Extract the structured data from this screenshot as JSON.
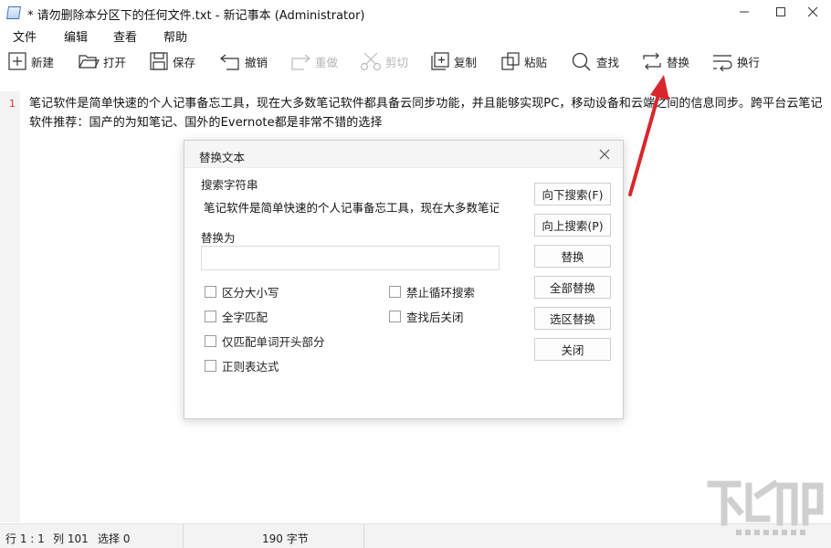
{
  "window": {
    "title": "* 请勿删除本分区下的任何文件.txt - 新记事本 (Administrator)",
    "icons": {
      "app": "notepad-icon",
      "minimize": "minimize-icon",
      "maximize": "maximize-icon",
      "close": "close-icon"
    }
  },
  "menu": {
    "items": [
      "文件",
      "编辑",
      "查看",
      "帮助"
    ]
  },
  "toolbar": {
    "new": "新建",
    "open": "打开",
    "save": "保存",
    "undo": "撤销",
    "redo": "重做",
    "cut": "剪切",
    "copy": "复制",
    "paste": "粘贴",
    "find": "查找",
    "replace": "替换",
    "wrap": "换行"
  },
  "editor": {
    "line_number": "1",
    "content": "笔记软件是简单快速的个人记事备忘工具，现在大多数笔记软件都具备云同步功能，并且能够实现PC，移动设备和云端之间的信息同步。跨平台云笔记软件推荐：国产的为知笔记、国外的Evernote都是非常不错的选择"
  },
  "dialog": {
    "title": "替换文本",
    "search_label": "搜索字符串",
    "search_value": "笔记软件是简单快速的个人记事备忘工具，现在大多数笔记软件都具备云同步功能，并且能够实现PC，移动设备和云端之间的信息同步。跨平台云笔记软件推荐：国产的为知笔记、国外的Evernote都是非常不错的选择",
    "replace_label": "替换为",
    "replace_value": "",
    "options": {
      "match_case": "区分大小写",
      "whole_word": "全字匹配",
      "word_start": "仅匹配单词开头部分",
      "regex": "正则表达式",
      "no_wrap": "禁止循环搜索",
      "close_after": "查找后关闭"
    },
    "buttons": {
      "find_next": "向下搜索(F)",
      "find_prev": "向上搜索(P)",
      "replace": "替换",
      "replace_all": "全部替换",
      "replace_selection": "选区替换",
      "close": "关闭"
    }
  },
  "statusbar": {
    "position": "行 1 : 1",
    "column": "列 101",
    "selection": "选择 0",
    "bytes": "190 字节"
  },
  "annotation": {
    "arrow_color": "#d9262c"
  }
}
